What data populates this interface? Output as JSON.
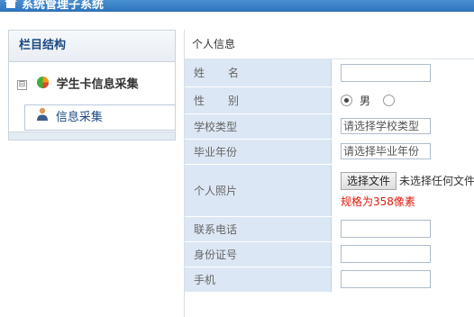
{
  "app": {
    "title": "系统管理子系统",
    "icon": "home-icon"
  },
  "sidebar": {
    "header": "栏目结构",
    "tree": {
      "toggle": "⊟",
      "node_icon": "pie-chart-icon",
      "node_label": "学生卡信息采集",
      "items": [
        {
          "icon": "person-icon",
          "label": "信息采集"
        }
      ]
    }
  },
  "form": {
    "section_title": "个人信息",
    "fields": {
      "name": {
        "label": "姓名",
        "value": ""
      },
      "gender": {
        "label": "性别",
        "options": [
          "男",
          ""
        ],
        "selected": "男"
      },
      "school_type": {
        "label": "学校类型",
        "value": "请选择学校类型"
      },
      "grad_year": {
        "label": "毕业年份",
        "value": "请选择毕业年份"
      },
      "photo": {
        "label": "个人照片",
        "button": "选择文件",
        "status": "未选择任何文件",
        "hint": "规格为358像素"
      },
      "phone": {
        "label": "联系电话",
        "value": ""
      },
      "id_card": {
        "label": "身份证号",
        "value": ""
      },
      "mobile": {
        "label": "手机",
        "value": ""
      }
    }
  },
  "colors": {
    "topbar": "#2f77c1",
    "label_bg": "#dbe7f4",
    "hint": "#e0180d"
  }
}
